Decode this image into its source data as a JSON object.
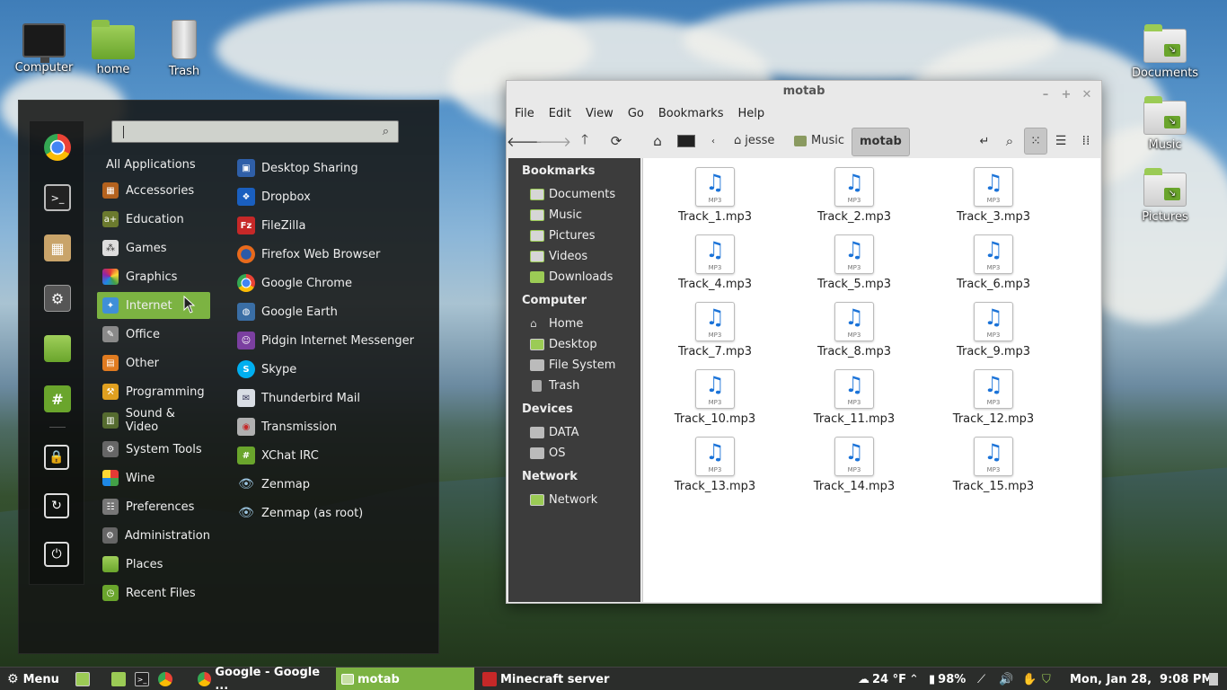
{
  "desktop": {
    "left_icons": [
      {
        "label": "Computer",
        "icon": "computer-icon"
      },
      {
        "label": "home",
        "icon": "home-folder-icon"
      },
      {
        "label": "Trash",
        "icon": "trash-icon"
      }
    ],
    "right_icons": [
      {
        "label": "Documents",
        "icon": "documents-folder-icon"
      },
      {
        "label": "Music",
        "icon": "music-folder-icon"
      },
      {
        "label": "Pictures",
        "icon": "pictures-folder-icon"
      }
    ]
  },
  "menu": {
    "search_value": "",
    "all_applications": "All Applications",
    "categories": [
      "Accessories",
      "Education",
      "Games",
      "Graphics",
      "Internet",
      "Office",
      "Other",
      "Programming",
      "Sound & Video",
      "System Tools",
      "Wine",
      "Preferences",
      "Administration",
      "Places",
      "Recent Files"
    ],
    "selected_category": "Internet",
    "apps": [
      "Desktop Sharing",
      "Dropbox",
      "FileZilla",
      "Firefox Web Browser",
      "Google Chrome",
      "Google Earth",
      "Pidgin Internet Messenger",
      "Skype",
      "Thunderbird Mail",
      "Transmission",
      "XChat IRC",
      "Zenmap",
      "Zenmap (as root)"
    ],
    "favorites": [
      "chrome-icon",
      "terminal-icon",
      "package-icon",
      "settings-icon",
      "files-icon",
      "hexchat-icon"
    ],
    "system_buttons": [
      "lock-icon",
      "logout-icon",
      "power-icon"
    ]
  },
  "filemanager": {
    "title": "motab",
    "menus": [
      "File",
      "Edit",
      "View",
      "Go",
      "Bookmarks",
      "Help"
    ],
    "breadcrumbs": [
      "jesse",
      "Music",
      "motab"
    ],
    "sidebar": {
      "bookmarks_heading": "Bookmarks",
      "bookmarks": [
        "Documents",
        "Music",
        "Pictures",
        "Videos",
        "Downloads"
      ],
      "computer_heading": "Computer",
      "computer": [
        "Home",
        "Desktop",
        "File System",
        "Trash"
      ],
      "devices_heading": "Devices",
      "devices": [
        "DATA",
        "OS"
      ],
      "network_heading": "Network",
      "network": [
        "Network"
      ]
    },
    "file_badge": "MP3",
    "files": [
      "Track_1.mp3",
      "Track_2.mp3",
      "Track_3.mp3",
      "Track_4.mp3",
      "Track_5.mp3",
      "Track_6.mp3",
      "Track_7.mp3",
      "Track_8.mp3",
      "Track_9.mp3",
      "Track_10.mp3",
      "Track_11.mp3",
      "Track_12.mp3",
      "Track_13.mp3",
      "Track_14.mp3",
      "Track_15.mp3"
    ]
  },
  "panel": {
    "menu_label": "Menu",
    "windows": [
      "Google - Google ...",
      "motab",
      "Minecraft server"
    ],
    "active_window": "motab",
    "weather": "24 °F",
    "battery": "98%",
    "clock": "Mon, Jan 28,  9:08 PM"
  },
  "colors": {
    "accent": "#7cb342",
    "sidebar_bg": "#3c3c3c",
    "panel_bg": "#2b2d2b",
    "mp3_note": "#1b73d8"
  }
}
